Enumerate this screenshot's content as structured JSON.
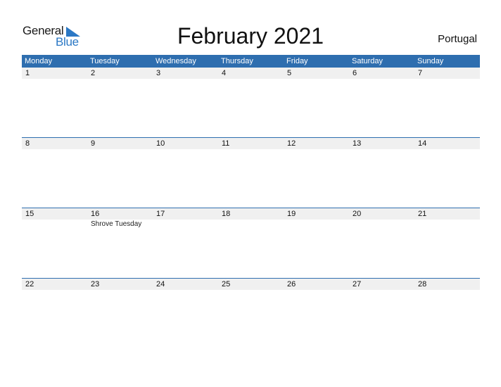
{
  "logo": {
    "text_top": "General",
    "text_bottom": "Blue",
    "accent_color": "#2b78c5"
  },
  "title": "February 2021",
  "country": "Portugal",
  "colors": {
    "header_bg": "#2e6eaf",
    "row_bg": "#f0f0f0"
  },
  "weekdays": [
    "Monday",
    "Tuesday",
    "Wednesday",
    "Thursday",
    "Friday",
    "Saturday",
    "Sunday"
  ],
  "weeks": [
    {
      "days": [
        "1",
        "2",
        "3",
        "4",
        "5",
        "6",
        "7"
      ],
      "events": [
        "",
        "",
        "",
        "",
        "",
        "",
        ""
      ]
    },
    {
      "days": [
        "8",
        "9",
        "10",
        "11",
        "12",
        "13",
        "14"
      ],
      "events": [
        "",
        "",
        "",
        "",
        "",
        "",
        ""
      ]
    },
    {
      "days": [
        "15",
        "16",
        "17",
        "18",
        "19",
        "20",
        "21"
      ],
      "events": [
        "",
        "Shrove Tuesday",
        "",
        "",
        "",
        "",
        ""
      ]
    },
    {
      "days": [
        "22",
        "23",
        "24",
        "25",
        "26",
        "27",
        "28"
      ],
      "events": [
        "",
        "",
        "",
        "",
        "",
        "",
        ""
      ]
    }
  ]
}
